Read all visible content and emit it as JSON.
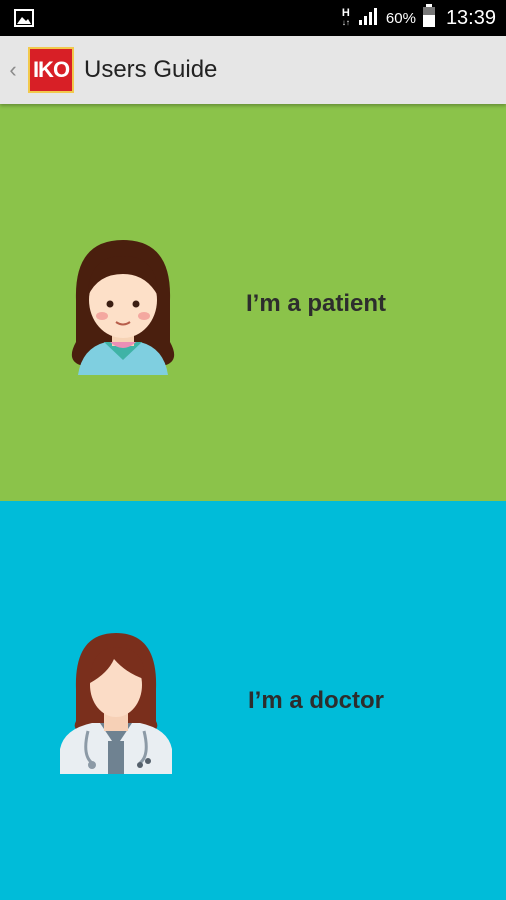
{
  "status_bar": {
    "network": "H",
    "network_sub": "↓↑",
    "battery": "60%",
    "time": "13:39",
    "icons": [
      "image-notification-icon",
      "signal-icon",
      "battery-icon"
    ]
  },
  "app_bar": {
    "logo_text": "IKO",
    "title": "Users Guide"
  },
  "options": {
    "patient": {
      "label": "I’m a patient",
      "color": "#8bc34a",
      "icon": "patient-avatar-icon"
    },
    "doctor": {
      "label": "I’m a doctor",
      "color": "#00bcd9",
      "icon": "doctor-avatar-icon"
    }
  }
}
